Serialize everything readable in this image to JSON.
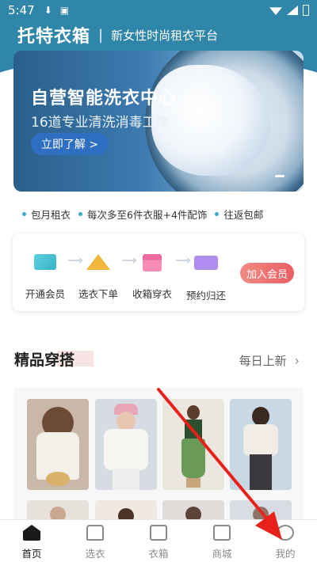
{
  "status_bar": {
    "time": "5:47"
  },
  "header": {
    "title": "托特衣箱",
    "separator": "|",
    "subtitle": "新女性时尚租衣平台"
  },
  "banner": {
    "title": "自营智能洗衣中心",
    "subtitle": "16道专业清洗消毒工序",
    "button": "立即了解 >"
  },
  "features": [
    "包月租衣",
    "每次多至6件衣服+4件配饰",
    "往返包邮"
  ],
  "steps": {
    "items": [
      {
        "label": "开通会员",
        "icon": "membership-card-icon"
      },
      {
        "label": "选衣下单",
        "icon": "hanger-icon"
      },
      {
        "label": "收箱穿衣",
        "icon": "box-icon"
      },
      {
        "label": "预约归还",
        "icon": "delivery-truck-icon"
      }
    ],
    "join_button": "加入会员"
  },
  "section": {
    "title": "精品穿搭",
    "more": "每日上新",
    "chevron": "›"
  },
  "tabs": [
    {
      "label": "首页",
      "icon": "home-icon",
      "active": true
    },
    {
      "label": "选衣",
      "icon": "shirt-icon",
      "active": false
    },
    {
      "label": "衣箱",
      "icon": "wardrobe-icon",
      "active": false
    },
    {
      "label": "商城",
      "icon": "store-icon",
      "active": false
    },
    {
      "label": "我的",
      "icon": "profile-icon",
      "active": false
    }
  ],
  "colors": {
    "header": "#2f86a8",
    "accent": "#e95e62",
    "feature_dot": "#3aa9c9",
    "annotation_arrow": "#e8221b"
  }
}
